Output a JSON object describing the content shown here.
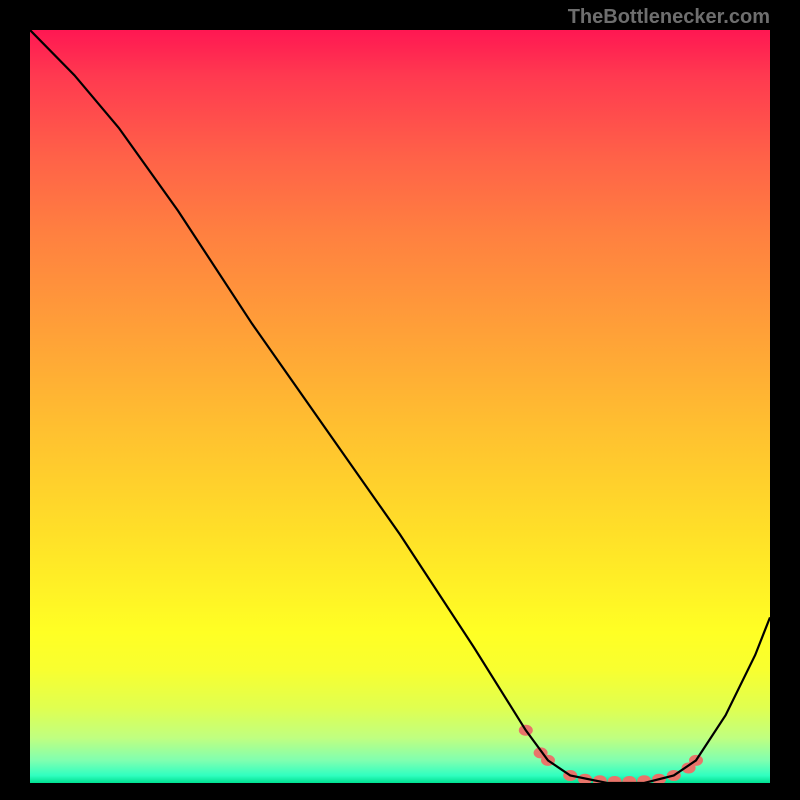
{
  "attribution": "TheBottlenecker.com",
  "chart_data": {
    "type": "line",
    "title": "",
    "xlabel": "",
    "ylabel": "",
    "xlim": [
      0,
      100
    ],
    "ylim": [
      0,
      100
    ],
    "curve": {
      "name": "bottleneck-curve",
      "color": "#000000",
      "points": [
        {
          "x": 0,
          "y": 100
        },
        {
          "x": 6,
          "y": 94
        },
        {
          "x": 12,
          "y": 87
        },
        {
          "x": 20,
          "y": 76
        },
        {
          "x": 30,
          "y": 61
        },
        {
          "x": 40,
          "y": 47
        },
        {
          "x": 50,
          "y": 33
        },
        {
          "x": 60,
          "y": 18
        },
        {
          "x": 67,
          "y": 7
        },
        {
          "x": 70,
          "y": 3
        },
        {
          "x": 73,
          "y": 1
        },
        {
          "x": 78,
          "y": 0
        },
        {
          "x": 83,
          "y": 0
        },
        {
          "x": 87,
          "y": 1
        },
        {
          "x": 90,
          "y": 3
        },
        {
          "x": 94,
          "y": 9
        },
        {
          "x": 98,
          "y": 17
        },
        {
          "x": 100,
          "y": 22
        }
      ]
    },
    "markers": {
      "name": "highlight-points",
      "color": "#e8746a",
      "points": [
        {
          "x": 67,
          "y": 7
        },
        {
          "x": 69,
          "y": 4
        },
        {
          "x": 70,
          "y": 3
        },
        {
          "x": 73,
          "y": 1
        },
        {
          "x": 75,
          "y": 0.5
        },
        {
          "x": 77,
          "y": 0.3
        },
        {
          "x": 79,
          "y": 0.2
        },
        {
          "x": 81,
          "y": 0.2
        },
        {
          "x": 83,
          "y": 0.3
        },
        {
          "x": 85,
          "y": 0.5
        },
        {
          "x": 87,
          "y": 1
        },
        {
          "x": 89,
          "y": 2
        },
        {
          "x": 90,
          "y": 3
        }
      ]
    }
  }
}
